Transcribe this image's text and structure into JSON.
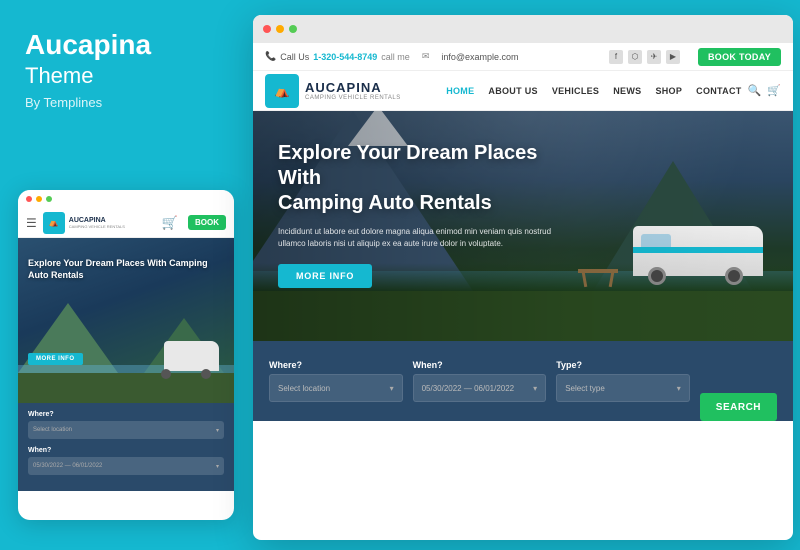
{
  "left": {
    "brand_name": "Aucapina",
    "brand_line2": "Theme",
    "brand_by": "By Templines"
  },
  "mobile": {
    "nav": {
      "logo_text": "AUCAPINA",
      "logo_sub": "CAMPING VEHICLE RENTALS",
      "book_label": "BOOK"
    },
    "hero": {
      "title": "Explore Your Dream Places With Camping Auto Rentals",
      "more_info": "MORE INFO"
    },
    "form": {
      "where_label": "Where?",
      "where_placeholder": "Select location",
      "when_label": "When?",
      "when_placeholder": "05/30/2022 — 06/01/2022"
    }
  },
  "browser": {
    "top_bar": {
      "call_label": "Call Us",
      "phone": "1-320-544-8749",
      "call_me": "call me",
      "email": "info@example.com",
      "book_today": "BOOK TODAY"
    },
    "nav": {
      "logo_text": "AUCAPINA",
      "logo_sub": "CAMPING VEHICLE RENTALS",
      "links": [
        "HOME",
        "ABOUT US",
        "VEHICLES",
        "NEWS",
        "SHOP",
        "CONTACT"
      ]
    },
    "hero": {
      "title": "Explore Your Dream Places With\nCamping Auto Rentals",
      "description": "Incididunt ut labore eut dolore magna aliqua enimod min veniam quis nostrud\nullamco laboris nisi ut aliquip ex ea aute irure dolor in voluptate.",
      "more_info": "MORE INFO"
    },
    "search": {
      "where_label": "Where?",
      "where_placeholder": "Select location",
      "when_label": "When?",
      "when_value": "05/30/2022 — 06/01/2022",
      "type_label": "Type?",
      "type_placeholder": "Select type",
      "search_btn": "SEARCH"
    }
  }
}
